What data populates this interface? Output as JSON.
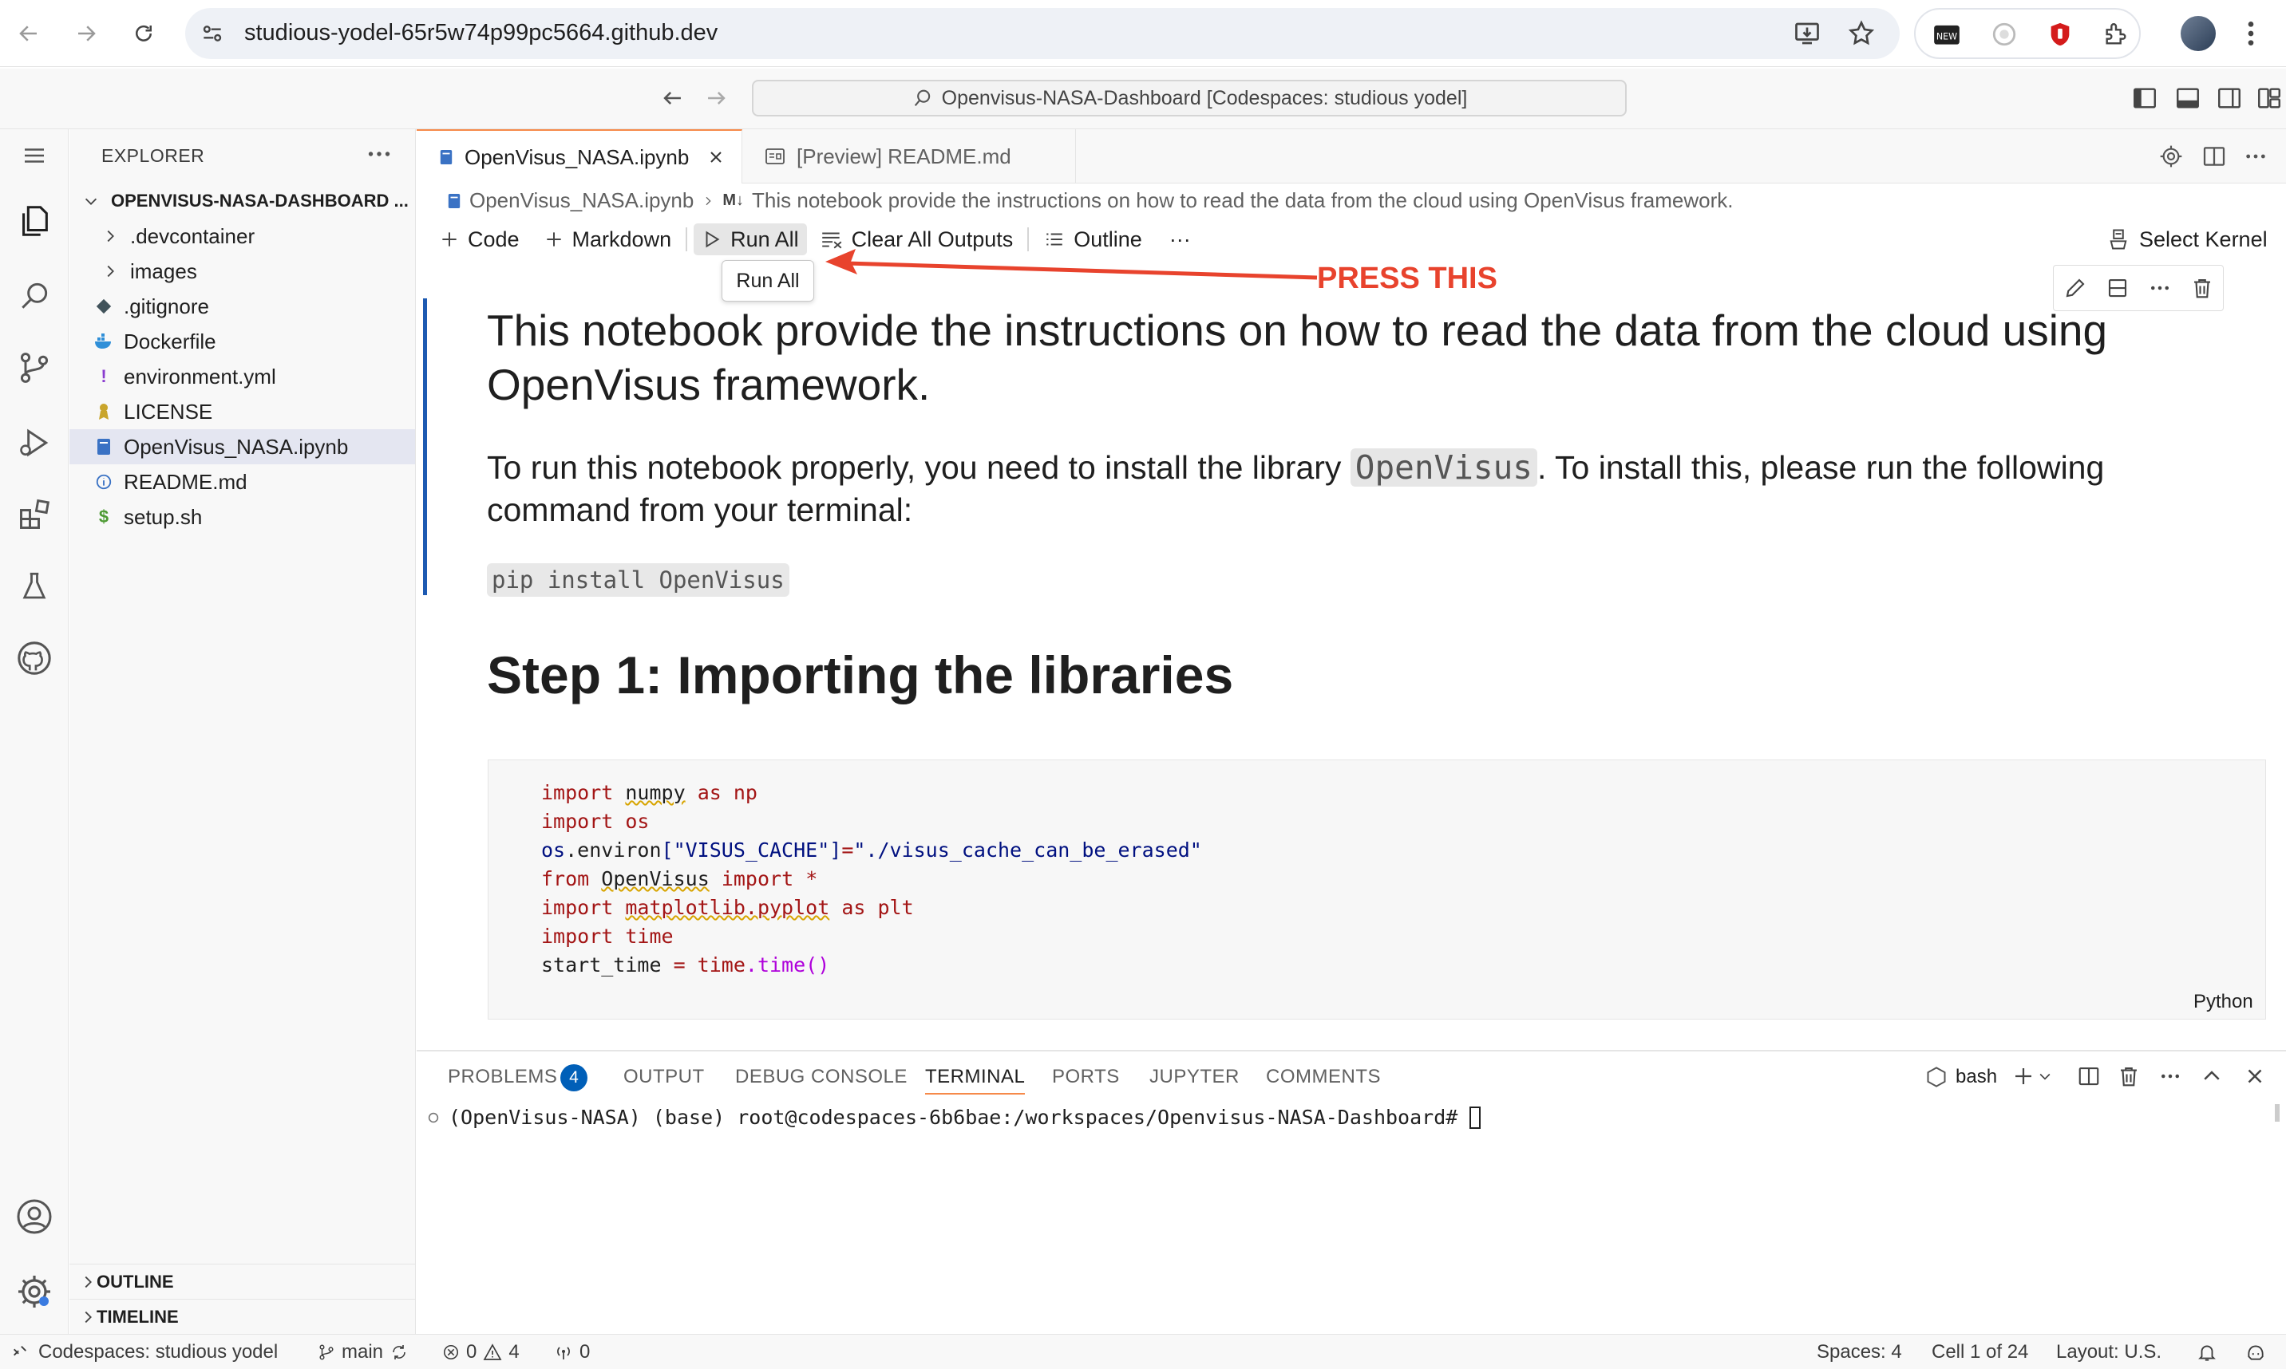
{
  "browser": {
    "url": "studious-yodel-65r5w74p99pc5664.github.dev"
  },
  "titlebar": {
    "command_center": "Openvisus-NASA-Dashboard [Codespaces: studious yodel]"
  },
  "sidebar": {
    "title": "EXPLORER",
    "root": "OPENVISUS-NASA-DASHBOARD ...",
    "items": [
      {
        "label": ".devcontainer"
      },
      {
        "label": "images"
      },
      {
        "label": ".gitignore"
      },
      {
        "label": "Dockerfile"
      },
      {
        "label": "environment.yml"
      },
      {
        "label": "LICENSE"
      },
      {
        "label": "OpenVisus_NASA.ipynb"
      },
      {
        "label": "README.md"
      },
      {
        "label": "setup.sh"
      }
    ],
    "outline": "OUTLINE",
    "timeline": "TIMELINE"
  },
  "tabs": [
    {
      "label": "OpenVisus_NASA.ipynb"
    },
    {
      "label": "[Preview] README.md"
    }
  ],
  "breadcrumb": {
    "file": "OpenVisus_NASA.ipynb",
    "md_marker": "M↓",
    "section": "This notebook provide the instructions on how to read the data from the cloud using OpenVisus framework."
  },
  "toolbar": {
    "code": "Code",
    "markdown": "Markdown",
    "run_all": "Run All",
    "clear_outputs": "Clear All Outputs",
    "outline": "Outline",
    "more": "···",
    "select_kernel": "Select Kernel",
    "tooltip": "Run All"
  },
  "annotation": {
    "text": "PRESS THIS",
    "color": "#e8432d"
  },
  "markdown_cell": {
    "h1": "This notebook provide the instructions on how to read the data from the cloud using OpenVisus framework.",
    "p_before": "To run this notebook properly, you need to install the library ",
    "p_code": "OpenVisus",
    "p_after": ". To install this, please run the following command from your terminal:",
    "code_block": "pip install OpenVisus",
    "h2": "Step 1: Importing the libraries"
  },
  "code_cell": {
    "language": "Python",
    "l1_kw": "import",
    "l1_mod": "numpy",
    "l1_as": "as",
    "l1_alias": "np",
    "l2_kw": "import",
    "l2_mod": "os",
    "l3_a": "os",
    "l3_b": ".environ",
    "l3_c": "[\"VISUS_CACHE\"]",
    "l3_d": "=",
    "l3_e": "\"./visus_cache_can_be_erased\"",
    "l4_kw": "from",
    "l4_mod": "OpenVisus",
    "l4_imp": "import",
    "l4_star": "*",
    "l5_kw": "import",
    "l5_mod": "matplotlib.pyplot",
    "l5_as": "as",
    "l5_alias": "plt",
    "l6_kw": "import",
    "l6_mod": "time",
    "l7_a": "start_time",
    "l7_b": " = ",
    "l7_c": "time",
    "l7_d": ".time()"
  },
  "panel": {
    "tabs": [
      "PROBLEMS",
      "OUTPUT",
      "DEBUG CONSOLE",
      "TERMINAL",
      "PORTS",
      "JUPYTER",
      "COMMENTS"
    ],
    "problems_count": "4",
    "shell": "bash",
    "terminal_line": "(OpenVisus-NASA) (base) root@codespaces-6b6bae:/workspaces/Openvisus-NASA-Dashboard# "
  },
  "statusbar": {
    "remote": "Codespaces: studious yodel",
    "branch": "main",
    "errors": "0",
    "warnings": "4",
    "ports": "0",
    "spaces": "Spaces: 4",
    "cell": "Cell 1 of 24",
    "layout": "Layout: U.S."
  },
  "colors": {
    "accent_blue": "#005fb8",
    "tab_accent": "#f68a4a",
    "cell_bar": "#1d5ab2"
  }
}
